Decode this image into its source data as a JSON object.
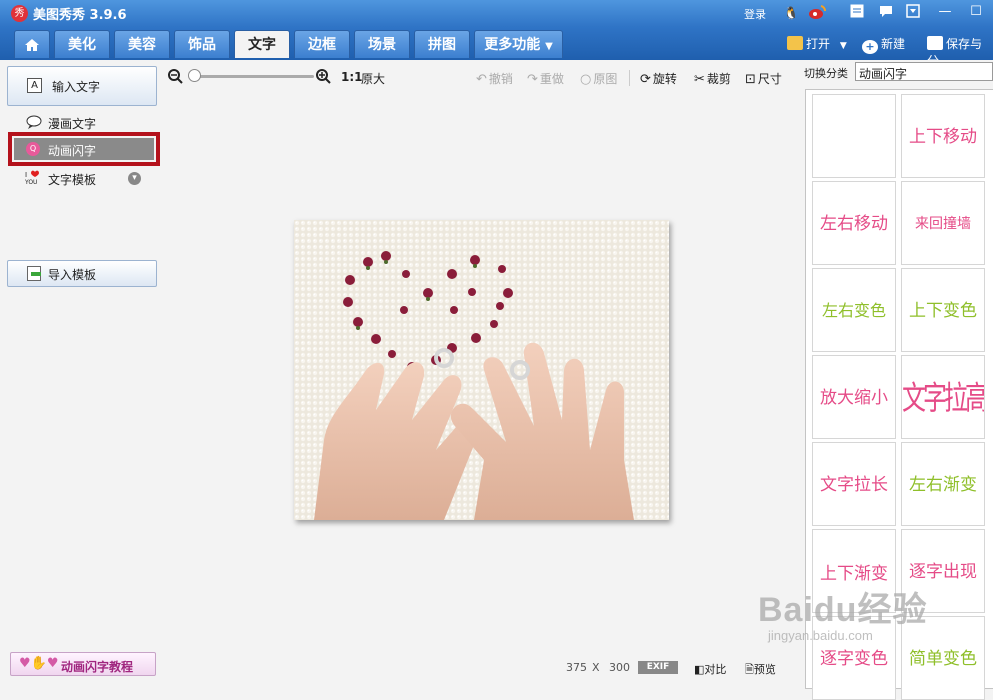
{
  "title_bar": {
    "app_title": "美图秀秀 3.9.6",
    "login": "登录",
    "icons": [
      "qq-icon",
      "weibo-icon",
      "notepad-icon",
      "message-icon",
      "dropdown-icon"
    ],
    "window_buttons": [
      "minimize",
      "maximize",
      "close"
    ]
  },
  "tabs": {
    "home_icon": "home-icon",
    "items": [
      {
        "label": "美化",
        "active": false
      },
      {
        "label": "美容",
        "active": false
      },
      {
        "label": "饰品",
        "active": false
      },
      {
        "label": "文字",
        "active": true
      },
      {
        "label": "边框",
        "active": false
      },
      {
        "label": "场景",
        "active": false
      },
      {
        "label": "拼图",
        "active": false
      },
      {
        "label": "更多功能",
        "active": false,
        "has_dropdown": true
      }
    ]
  },
  "file_actions": {
    "open": "打开",
    "new": "新建",
    "save": "保存与分"
  },
  "left_panel": {
    "input_text": "输入文字",
    "items": [
      {
        "label": "漫画文字",
        "icon": "speech-bubble-icon"
      },
      {
        "label": "动画闪字",
        "icon": "flash-text-icon",
        "selected": true
      },
      {
        "label": "文字模板",
        "icon": "love-you-icon",
        "has_dropdown": true
      }
    ],
    "import_template": "导入模板",
    "tutorial": "动画闪字教程"
  },
  "toolbar": {
    "zoom_reset": "1:1",
    "original_size": "原大",
    "undo": "撤销",
    "redo": "重做",
    "original": "原图",
    "rotate": "旋转",
    "crop": "裁剪",
    "resize": "尺寸",
    "zoom_level": 0.05
  },
  "canvas": {
    "image_description_icon": "photo-hands-heart",
    "width": "375",
    "height": "300",
    "times": "X",
    "exif": "EXIF",
    "compare": "对比",
    "preview": "预览"
  },
  "right_panel": {
    "category_label": "切换分类",
    "category_value": "动画闪字",
    "styles": [
      {
        "label": "",
        "color": "#ffffff"
      },
      {
        "label": "上下移动",
        "color": "#e54b87"
      },
      {
        "label": "左右移动",
        "color": "#e54b87"
      },
      {
        "label": "来回撞墙",
        "color": "#e54b87"
      },
      {
        "label": "左右变色",
        "color": "#8fbf2a"
      },
      {
        "label": "上下变色",
        "color": "#8fbf2a"
      },
      {
        "label": "放大缩小",
        "color": "#e54b87"
      },
      {
        "label": "文字拉高",
        "color": "#e54b87"
      },
      {
        "label": "文字拉长",
        "color": "#e54b87"
      },
      {
        "label": "左右渐变",
        "color": "#8fbf2a"
      },
      {
        "label": "上下渐变",
        "color": "#e54b87"
      },
      {
        "label": "逐字出现",
        "color": "#e54b87"
      },
      {
        "label": "逐字变色",
        "color": "#e54b87"
      },
      {
        "label": "简单变色",
        "color": "#8fbf2a"
      }
    ]
  },
  "watermark": {
    "text": "Baidu经验",
    "url": "jingyan.baidu.com"
  }
}
